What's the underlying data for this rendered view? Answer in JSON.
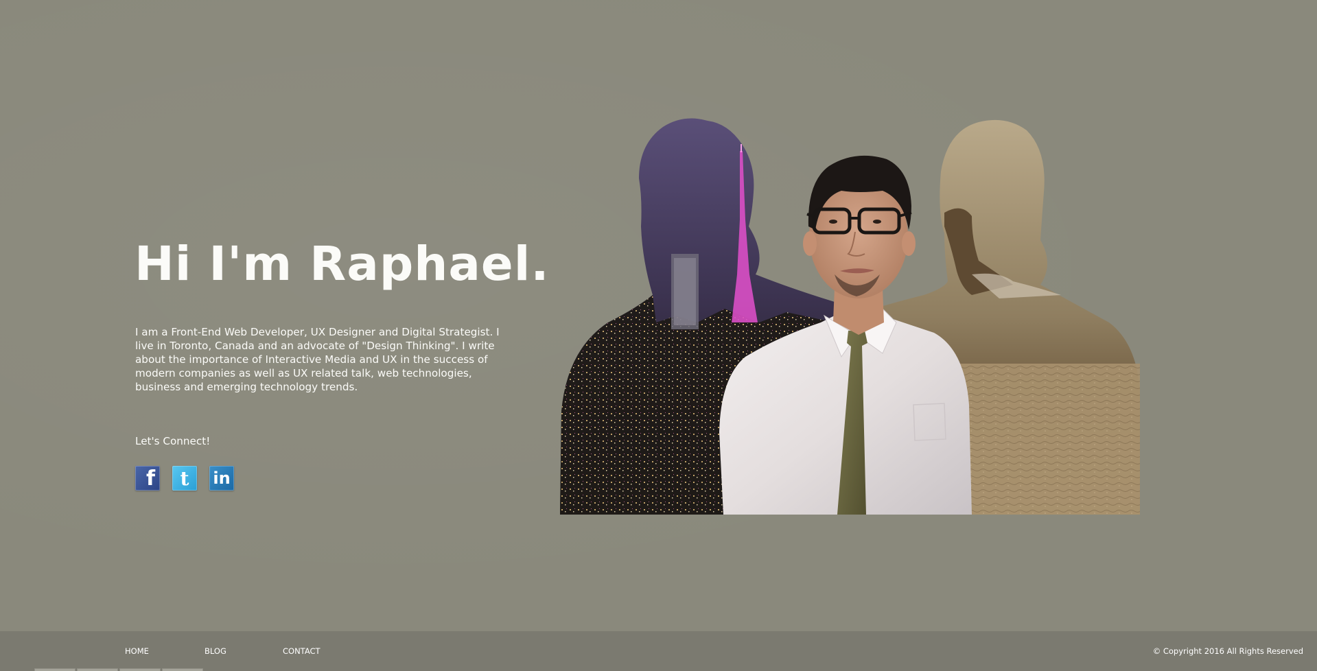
{
  "hero": {
    "title": "Hi I'm Raphael.",
    "intro": "I am a Front-End Web Developer, UX Designer and Digital Strategist. I live in Toronto, Canada and an advocate of \"Design Thinking\". I write about the importance of Interactive Media and UX in the success of modern companies as well as UX related talk, web technologies, business and emerging technology trends.",
    "connect_label": "Let's Connect!"
  },
  "social": [
    {
      "name": "facebook-icon",
      "glyph": "f"
    },
    {
      "name": "twitter-icon",
      "glyph": "t"
    },
    {
      "name": "linkedin-icon",
      "glyph": "in"
    }
  ],
  "footer": {
    "nav": [
      "HOME",
      "BLOG",
      "CONTACT"
    ],
    "copyright": "© Copyright 2016 All Rights Reserved"
  },
  "colors": {
    "background": "#8a897c",
    "footer": "#7b7a70",
    "text": "#fbfbf8",
    "facebook": "#3b5998",
    "twitter": "#3db3e8",
    "linkedin": "#2a7ab8"
  }
}
